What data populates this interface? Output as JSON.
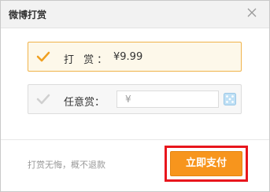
{
  "dialog": {
    "title": "微博打赏",
    "close_icon": "close-icon"
  },
  "options": [
    {
      "label": "打 赏：",
      "value": "¥9.99",
      "selected": true,
      "icon": "checkmark-icon"
    },
    {
      "label": "任意赏：",
      "placeholder": "¥",
      "selected": false,
      "icon": "checkmark-icon",
      "random_icon": "dice-icon"
    }
  ],
  "footer": {
    "note": "打赏无悔，概不退款",
    "pay_label": "立即支付"
  },
  "colors": {
    "accent": "#f7951d",
    "highlight_border": "#e8161d",
    "selected_bg": "#fdf8ea"
  }
}
